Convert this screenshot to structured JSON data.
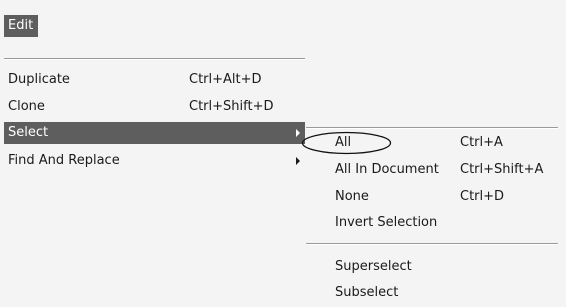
{
  "menu": {
    "title": "Edit",
    "items": [
      {
        "label": "Duplicate",
        "shortcut": "Ctrl+Alt+D"
      },
      {
        "label": "Clone",
        "shortcut": "Ctrl+Shift+D"
      },
      {
        "label": "Select",
        "shortcut": ""
      },
      {
        "label": "Find And Replace",
        "shortcut": ""
      }
    ]
  },
  "submenu": {
    "items": [
      {
        "label": "All",
        "shortcut": "Ctrl+A"
      },
      {
        "label": "All In Document",
        "shortcut": "Ctrl+Shift+A"
      },
      {
        "label": "None",
        "shortcut": "Ctrl+D"
      },
      {
        "label": "Invert Selection",
        "shortcut": ""
      },
      {
        "label": "Superselect",
        "shortcut": ""
      },
      {
        "label": "Subselect",
        "shortcut": ""
      }
    ]
  },
  "colors": {
    "highlight_bg": "#5e5e5e",
    "highlight_text": "#ffffff",
    "menu_bg": "#f4f4f4"
  }
}
